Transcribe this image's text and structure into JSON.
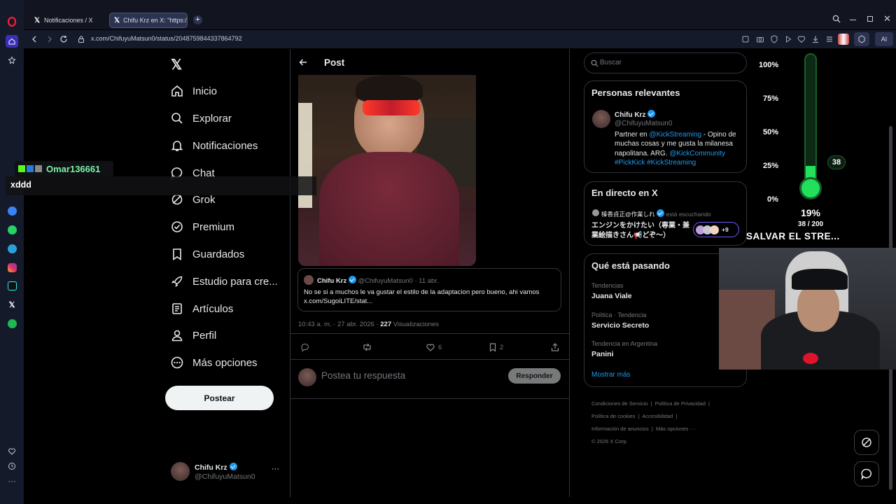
{
  "browser": {
    "tabs": [
      {
        "label": "Notificaciones / X"
      },
      {
        "label": "Chifu Krz en X: \"https://t..."
      }
    ],
    "url": "x.com/ChifuyuMatsun0/status/2048759844337864792",
    "ai_label": "AI"
  },
  "nav": {
    "items": [
      {
        "label": "Inicio",
        "icon": "home-icon"
      },
      {
        "label": "Explorar",
        "icon": "search-icon"
      },
      {
        "label": "Notificaciones",
        "icon": "bell-icon"
      },
      {
        "label": "Chat",
        "icon": "chat-icon"
      },
      {
        "label": "Grok",
        "icon": "grok-icon"
      },
      {
        "label": "Premium",
        "icon": "premium-icon"
      },
      {
        "label": "Guardados",
        "icon": "bookmark-icon"
      },
      {
        "label": "Estudio para cre...",
        "icon": "rocket-icon"
      },
      {
        "label": "Artículos",
        "icon": "article-icon"
      },
      {
        "label": "Perfil",
        "icon": "person-icon"
      },
      {
        "label": "Más opciones",
        "icon": "more-circle-icon"
      }
    ],
    "post_button": "Postear",
    "account": {
      "name": "Chifu Krz",
      "handle": "@ChifuyuMatsun0",
      "more": "···"
    }
  },
  "overlay_chat": {
    "username": "Omar136661",
    "message": "xddd"
  },
  "post": {
    "header_title": "Post",
    "quoted": {
      "name": "Chifu Krz",
      "handle": "@ChifuyuMatsun0",
      "date": "· 11 abr.",
      "text": "No se si a muchos le va gustar el estilo de la adaptacion pero bueno, ahi vamos",
      "link": "x.com/SugoiLITE/stat..."
    },
    "timestamp": "10:43 a. m. · 27 abr. 2026 · ",
    "views_count": "227",
    "views_label": "Visualizaciones",
    "likes": "6",
    "bookmarks": "2",
    "reply_placeholder": "Postea tu respuesta",
    "reply_button": "Responder"
  },
  "sidebar": {
    "search_placeholder": "Buscar",
    "relevant": {
      "title": "Personas relevantes",
      "name": "Chifu Krz",
      "handle": "@ChifuyuMatsun0",
      "bio_1": "Partner en ",
      "bio_link_1": "@KickStreaming",
      "bio_2": " - Opino de muchas cosas y me gusta la milanesa napolitana. ARG. ",
      "bio_link_2": "@KickCommunity",
      "bio_tags": "#PickKick #KickStreaming"
    },
    "live": {
      "title": "En directo en X",
      "host": "榛香貞正@作業しれ",
      "status": "está escuchando",
      "text": "エンジンをかけたい（専業・兼業絵描きさん📢どぞ〜）",
      "more_count": "+9"
    },
    "trends": {
      "title": "Qué está pasando",
      "items": [
        {
          "category": "Tendencias",
          "name": "Juana Viale"
        },
        {
          "category": "Política · Tendencia",
          "name": "Servicio Secreto"
        },
        {
          "category": "Tendencia en Argentina",
          "name": "Panini"
        }
      ],
      "show_more": "Mostrar más"
    },
    "footer": {
      "links": [
        "Condiciones de Servicio",
        "Política de Privacidad",
        "Política de cookies",
        "Accesibilidad",
        "Información de anuncios",
        "Más opciones ···"
      ],
      "copyright": "© 2026 X Corp."
    }
  },
  "goal_meter": {
    "ticks": [
      "100%",
      "75%",
      "50%",
      "25%",
      "0%"
    ],
    "level_fraction": 0.19,
    "count_badge": "38",
    "percent": "19%",
    "progress": "38 / 200",
    "title": "SALVAR EL STRE...",
    "colors": {
      "fill": "#22e05a",
      "tube": "#0c2a14"
    }
  }
}
